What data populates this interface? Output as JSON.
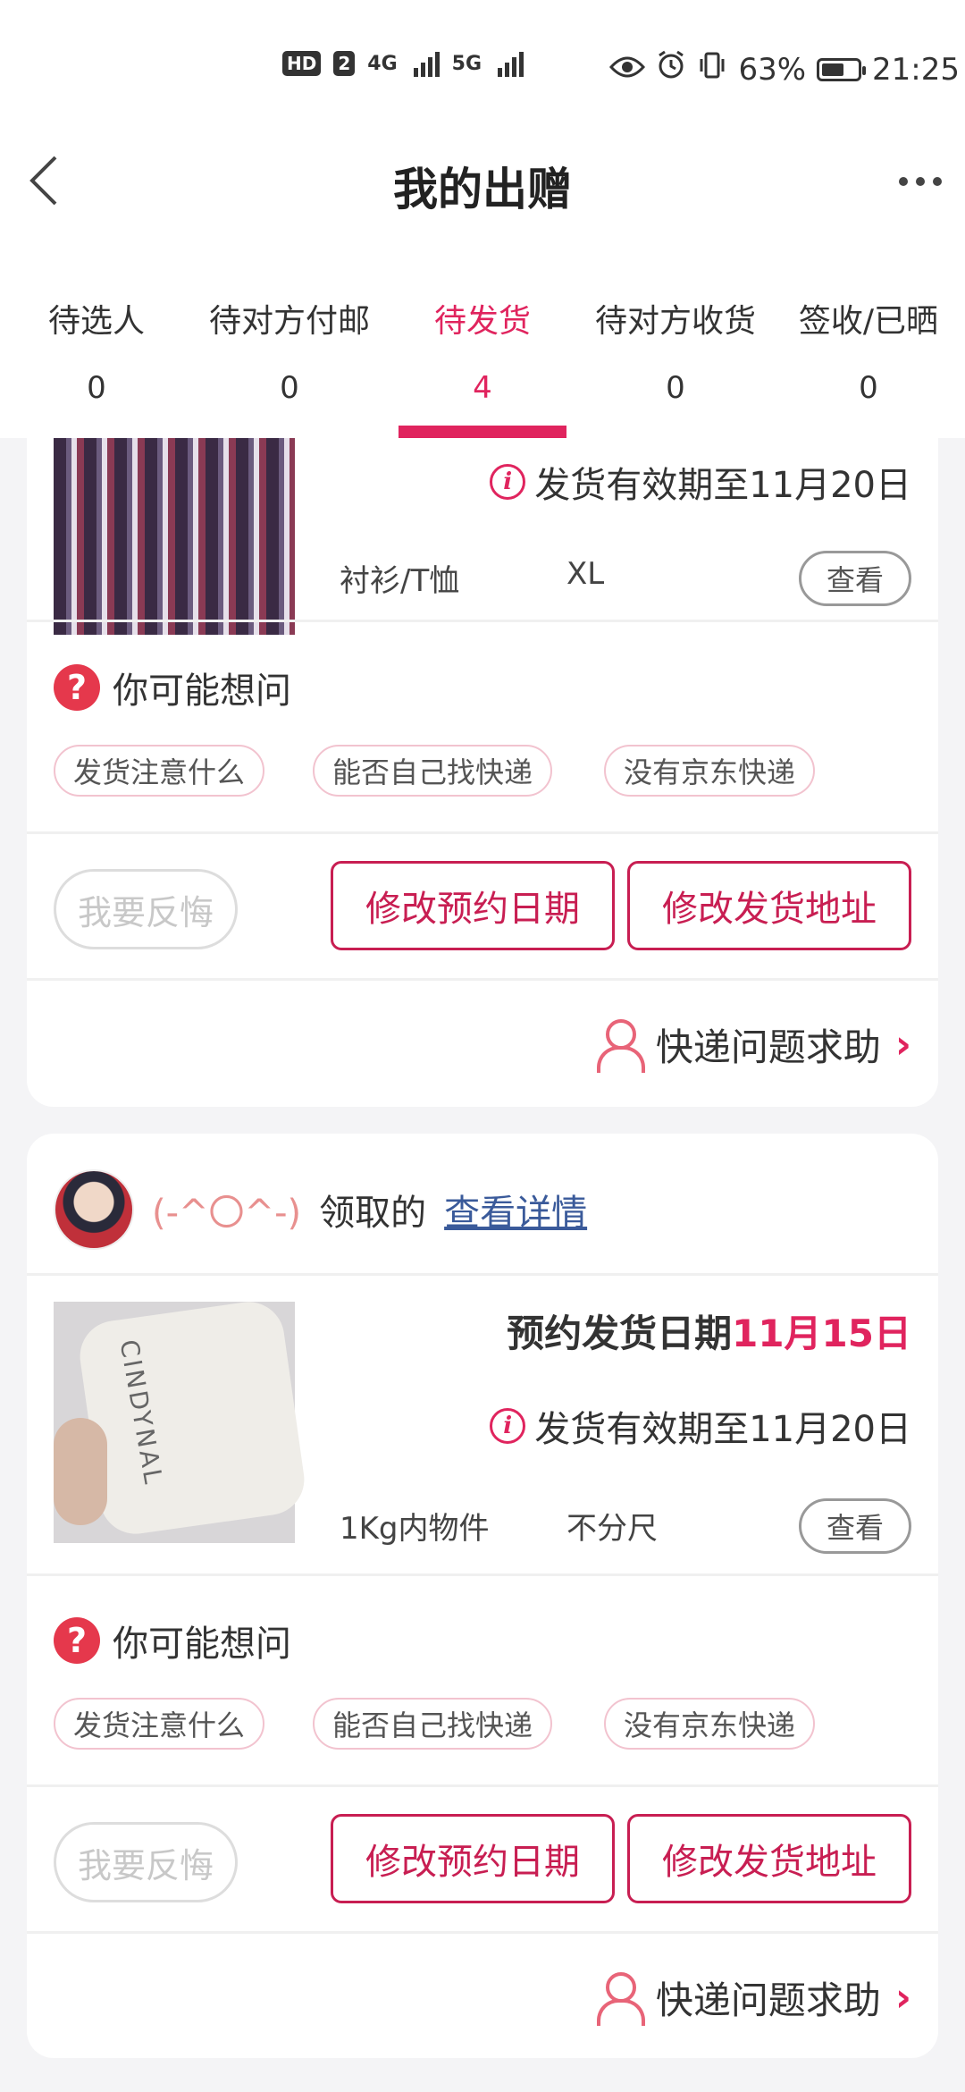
{
  "status_bar": {
    "hd": "HD",
    "sim": "2",
    "net1": "4G",
    "net2": "5G",
    "battery_pct": "63%",
    "battery_level": 0.63,
    "time": "21:25",
    "icons": [
      "eye-icon",
      "alarm-icon",
      "vibrate-icon"
    ]
  },
  "nav": {
    "title": "我的出赠"
  },
  "tabs": [
    {
      "label": "待选人",
      "count": "0",
      "active": false
    },
    {
      "label": "待对方付邮",
      "count": "0",
      "active": false
    },
    {
      "label": "待发货",
      "count": "4",
      "active": true
    },
    {
      "label": "待对方收货",
      "count": "0",
      "active": false
    },
    {
      "label": "签收/已晒",
      "count": "0",
      "active": false
    }
  ],
  "colors": {
    "accent": "#e0245e",
    "button_border": "#c81e52"
  },
  "card1": {
    "deadline": "发货有效期至11月20日",
    "category": "衬衫/T恤",
    "size": "XL",
    "view": "查看",
    "faq_title": "你可能想问",
    "chips": [
      "发货注意什么",
      "能否自己找快递",
      "没有京东快递"
    ],
    "regret": "我要反悔",
    "change_date": "修改预约日期",
    "change_addr": "修改发货地址",
    "help": "快递问题求助"
  },
  "card2": {
    "giver_name": "(-^〇^-)",
    "giver_suffix": "领取的",
    "detail_link": "查看详情",
    "reserve_label": "预约发货日期",
    "reserve_date": "11月15日",
    "deadline": "发货有效期至11月20日",
    "category": "1Kg内物件",
    "size": "不分尺",
    "view": "查看",
    "faq_title": "你可能想问",
    "chips": [
      "发货注意什么",
      "能否自己找快递",
      "没有京东快递"
    ],
    "regret": "我要反悔",
    "change_date": "修改预约日期",
    "change_addr": "修改发货地址",
    "help": "快递问题求助"
  },
  "product_image_text": "CINDYNAL"
}
